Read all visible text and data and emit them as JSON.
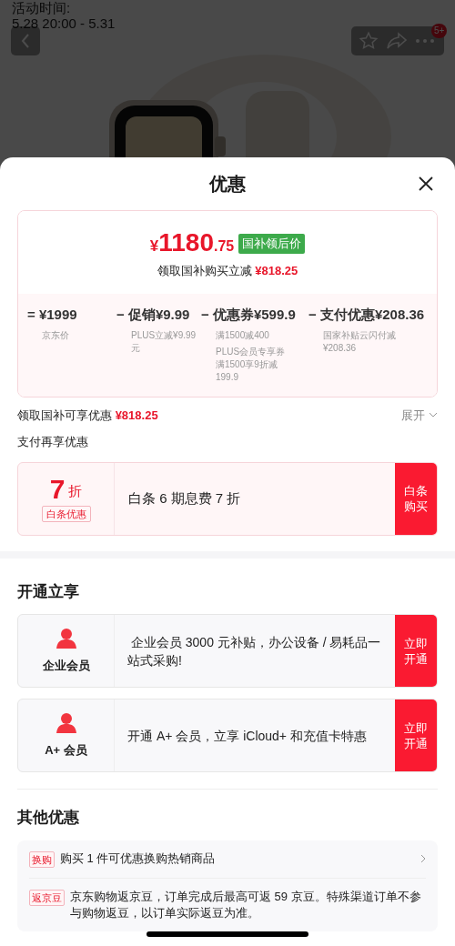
{
  "background": {
    "activity_label": "活动时间:",
    "activity_time": "5.28 20:00 - 5.31",
    "cart_badge": "5+"
  },
  "sheet": {
    "title": "优惠",
    "price_card": {
      "currency": "¥",
      "integer": "1180",
      "decimal": ".75",
      "tag": "国补领后价",
      "subtitle": "领取国补购买立减",
      "subtitle_amount": "¥818.25",
      "breakdown": [
        {
          "op": "=",
          "label": "¥1999",
          "notes": [
            "京东价"
          ]
        },
        {
          "op": "−",
          "label": "促销¥9.99",
          "notes": [
            "PLUS立减¥9.99元"
          ]
        },
        {
          "op": "−",
          "label": "优惠券¥599.9",
          "notes": [
            "满1500减400",
            "PLUS会员专享券满1500享9折减199.9"
          ]
        },
        {
          "op": "−",
          "label": "支付优惠¥208.36",
          "notes": [
            "国家补贴云闪付减¥208.36"
          ]
        }
      ]
    },
    "subsidy_line": {
      "label": "领取国补可享优惠",
      "amount": "¥818.25",
      "expand": "展开",
      "expanded": false
    },
    "pay_heading": "支付再享优惠",
    "pay_offers": [
      {
        "big": "7",
        "unit": "折",
        "tag": "白条优惠",
        "text": "白条 6 期息费 7 折",
        "action": "白条购买"
      }
    ],
    "member_heading": "开通立享",
    "member_offers": [
      {
        "name": "企业会员",
        "text": " 企业会员 3000 元补贴，办公设备 / 易耗品一站式采购!",
        "action": "立即开通"
      },
      {
        "name": "A+ 会员",
        "text": "开通 A+ 会员，立享 iCloud+ 和充值卡特惠",
        "action": "立即开通"
      }
    ],
    "other_heading": "其他优惠",
    "other_offers": [
      {
        "tag": "换购",
        "text": "购买 1 件可优惠换购热销商品",
        "link": true
      },
      {
        "tag": "返京豆",
        "text": "京东购物返京豆，订单完成后最高可返 59 京豆。特殊渠道订单不参与购物返豆，以订单实际返豆为准。",
        "link": false
      }
    ]
  }
}
